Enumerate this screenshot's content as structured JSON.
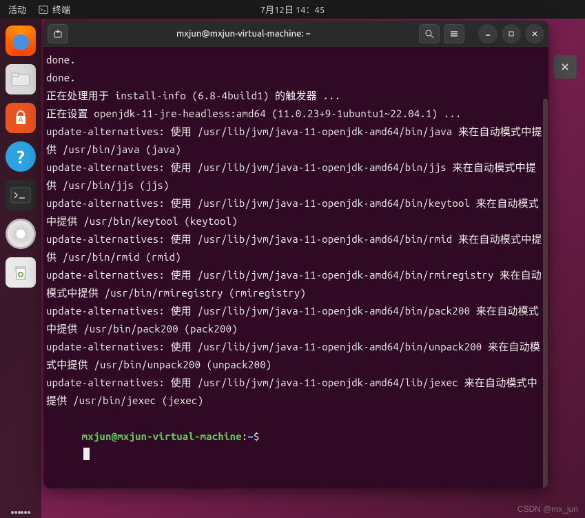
{
  "topbar": {
    "activities": "活动",
    "app_label": "终端",
    "clock": "7月12日 14：45"
  },
  "dock": {
    "items": [
      {
        "name": "firefox-icon",
        "glyph": "firefox"
      },
      {
        "name": "files-icon",
        "glyph": "files"
      },
      {
        "name": "software-icon",
        "glyph": "software"
      },
      {
        "name": "help-icon",
        "glyph": "help"
      },
      {
        "name": "terminal-icon",
        "glyph": "terminal",
        "active": true
      },
      {
        "name": "disk-icon",
        "glyph": "disk"
      },
      {
        "name": "trash-icon",
        "glyph": "trash"
      }
    ]
  },
  "window": {
    "title": "mxjun@mxjun-virtual-machine: ~"
  },
  "terminal": {
    "lines": [
      "done.",
      "done.",
      "正在处理用于 install-info (6.8-4build1) 的触发器 ...",
      "正在设置 openjdk-11-jre-headless:amd64 (11.0.23+9-1ubuntu1~22.04.1) ...",
      "update-alternatives: 使用 /usr/lib/jvm/java-11-openjdk-amd64/bin/java 来在自动模式中提供 /usr/bin/java (java)",
      "update-alternatives: 使用 /usr/lib/jvm/java-11-openjdk-amd64/bin/jjs 来在自动模式中提供 /usr/bin/jjs (jjs)",
      "update-alternatives: 使用 /usr/lib/jvm/java-11-openjdk-amd64/bin/keytool 来在自动模式中提供 /usr/bin/keytool (keytool)",
      "update-alternatives: 使用 /usr/lib/jvm/java-11-openjdk-amd64/bin/rmid 来在自动模式中提供 /usr/bin/rmid (rmid)",
      "update-alternatives: 使用 /usr/lib/jvm/java-11-openjdk-amd64/bin/rmiregistry 来在自动模式中提供 /usr/bin/rmiregistry (rmiregistry)",
      "update-alternatives: 使用 /usr/lib/jvm/java-11-openjdk-amd64/bin/pack200 来在自动模式中提供 /usr/bin/pack200 (pack200)",
      "update-alternatives: 使用 /usr/lib/jvm/java-11-openjdk-amd64/bin/unpack200 来在自动模式中提供 /usr/bin/unpack200 (unpack200)",
      "update-alternatives: 使用 /usr/lib/jvm/java-11-openjdk-amd64/lib/jexec 来在自动模式中提供 /usr/bin/jexec (jexec)"
    ],
    "prompt": {
      "user_host": "mxjun@mxjun-virtual-machine",
      "sep": ":",
      "path": "~",
      "symbol": "$"
    }
  },
  "watermark": "CSDN @mx_jun"
}
